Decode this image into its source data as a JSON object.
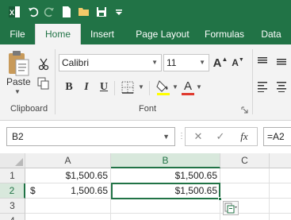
{
  "colors": {
    "accent": "#217346",
    "ribbon_bg": "#f3f3f3"
  },
  "quick_access": {
    "undo_icon": "undo-icon",
    "redo_icon": "redo-icon",
    "new_icon": "new-file-icon",
    "open_icon": "open-folder-icon",
    "save_icon": "save-icon",
    "customize_icon": "customize-qat-icon"
  },
  "tabs": [
    {
      "label": "File"
    },
    {
      "label": "Home"
    },
    {
      "label": "Insert"
    },
    {
      "label": "Page Layout"
    },
    {
      "label": "Formulas"
    },
    {
      "label": "Data"
    }
  ],
  "ribbon": {
    "clipboard": {
      "paste_label": "Paste",
      "group_label": "Clipboard"
    },
    "font": {
      "font_name": "Calibri",
      "font_size": "11",
      "group_label": "Font",
      "bold": "B",
      "italic": "I",
      "underline": "U",
      "grow": "A",
      "shrink": "A",
      "font_color_letter": "A"
    }
  },
  "formula_bar": {
    "name_box": "B2",
    "cancel_symbol": "✕",
    "enter_symbol": "✓",
    "fx_symbol": "fx",
    "formula": "=A2"
  },
  "grid": {
    "columns": [
      "A",
      "B",
      "C"
    ],
    "rows": [
      "1",
      "2",
      "3",
      "4"
    ],
    "cells": {
      "A1": "$1,500.65",
      "B1": "$1,500.65",
      "A2_currency": "$",
      "A2_value": "1,500.65",
      "B2": "$1,500.65"
    },
    "selected": "B2"
  }
}
